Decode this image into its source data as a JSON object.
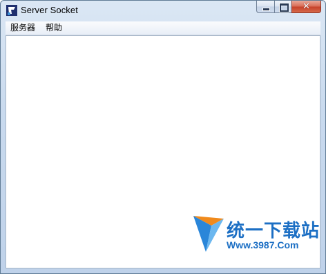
{
  "window": {
    "title": "Server Socket",
    "controls": {
      "close_glyph": "✕"
    }
  },
  "menubar": {
    "items": [
      {
        "label": "服务器"
      },
      {
        "label": "帮助"
      }
    ]
  },
  "watermark": {
    "text": "统一下载站",
    "url": "Www.3987.Com"
  },
  "colors": {
    "frame": "#c9daee",
    "close": "#c7432b",
    "watermark": "#1c6fc4"
  }
}
